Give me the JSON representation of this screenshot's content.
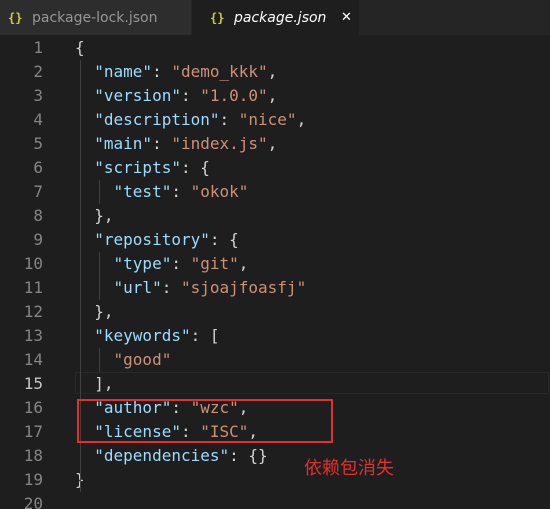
{
  "tabs": [
    {
      "icon": "{}",
      "label": "package-lock.json"
    },
    {
      "icon": "{}",
      "label": "package.json",
      "close": "✕"
    }
  ],
  "lines": [
    {
      "n": "1",
      "tokens": [
        {
          "t": "{",
          "c": "punc"
        }
      ]
    },
    {
      "n": "2",
      "tokens": [
        {
          "t": "  ",
          "c": "punc"
        },
        {
          "t": "\"name\"",
          "c": "key"
        },
        {
          "t": ": ",
          "c": "punc"
        },
        {
          "t": "\"demo_kkk\"",
          "c": "str"
        },
        {
          "t": ",",
          "c": "punc"
        }
      ]
    },
    {
      "n": "3",
      "tokens": [
        {
          "t": "  ",
          "c": "punc"
        },
        {
          "t": "\"version\"",
          "c": "key"
        },
        {
          "t": ": ",
          "c": "punc"
        },
        {
          "t": "\"1.0.0\"",
          "c": "str"
        },
        {
          "t": ",",
          "c": "punc"
        }
      ]
    },
    {
      "n": "4",
      "tokens": [
        {
          "t": "  ",
          "c": "punc"
        },
        {
          "t": "\"description\"",
          "c": "key"
        },
        {
          "t": ": ",
          "c": "punc"
        },
        {
          "t": "\"nice\"",
          "c": "str"
        },
        {
          "t": ",",
          "c": "punc"
        }
      ]
    },
    {
      "n": "5",
      "tokens": [
        {
          "t": "  ",
          "c": "punc"
        },
        {
          "t": "\"main\"",
          "c": "key"
        },
        {
          "t": ": ",
          "c": "punc"
        },
        {
          "t": "\"index.js\"",
          "c": "str"
        },
        {
          "t": ",",
          "c": "punc"
        }
      ]
    },
    {
      "n": "6",
      "tokens": [
        {
          "t": "  ",
          "c": "punc"
        },
        {
          "t": "\"scripts\"",
          "c": "key"
        },
        {
          "t": ": {",
          "c": "punc"
        }
      ]
    },
    {
      "n": "7",
      "tokens": [
        {
          "t": "    ",
          "c": "punc"
        },
        {
          "t": "\"test\"",
          "c": "key"
        },
        {
          "t": ": ",
          "c": "punc"
        },
        {
          "t": "\"okok\"",
          "c": "str"
        }
      ]
    },
    {
      "n": "8",
      "tokens": [
        {
          "t": "  },",
          "c": "punc"
        }
      ]
    },
    {
      "n": "9",
      "tokens": [
        {
          "t": "  ",
          "c": "punc"
        },
        {
          "t": "\"repository\"",
          "c": "key"
        },
        {
          "t": ": {",
          "c": "punc"
        }
      ]
    },
    {
      "n": "10",
      "tokens": [
        {
          "t": "    ",
          "c": "punc"
        },
        {
          "t": "\"type\"",
          "c": "key"
        },
        {
          "t": ": ",
          "c": "punc"
        },
        {
          "t": "\"git\"",
          "c": "str"
        },
        {
          "t": ",",
          "c": "punc"
        }
      ]
    },
    {
      "n": "11",
      "tokens": [
        {
          "t": "    ",
          "c": "punc"
        },
        {
          "t": "\"url\"",
          "c": "key"
        },
        {
          "t": ": ",
          "c": "punc"
        },
        {
          "t": "\"sjoajfoasfj\"",
          "c": "str"
        }
      ]
    },
    {
      "n": "12",
      "tokens": [
        {
          "t": "  },",
          "c": "punc"
        }
      ]
    },
    {
      "n": "13",
      "tokens": [
        {
          "t": "  ",
          "c": "punc"
        },
        {
          "t": "\"keywords\"",
          "c": "key"
        },
        {
          "t": ": [",
          "c": "punc"
        }
      ]
    },
    {
      "n": "14",
      "tokens": [
        {
          "t": "    ",
          "c": "punc"
        },
        {
          "t": "\"good\"",
          "c": "str"
        }
      ]
    },
    {
      "n": "15",
      "tokens": [
        {
          "t": "  ],",
          "c": "punc"
        }
      ],
      "current": true
    },
    {
      "n": "16",
      "tokens": [
        {
          "t": "  ",
          "c": "punc"
        },
        {
          "t": "\"author\"",
          "c": "key"
        },
        {
          "t": ": ",
          "c": "punc"
        },
        {
          "t": "\"wzc\"",
          "c": "str"
        },
        {
          "t": ",",
          "c": "punc"
        }
      ]
    },
    {
      "n": "17",
      "tokens": [
        {
          "t": "  ",
          "c": "punc"
        },
        {
          "t": "\"license\"",
          "c": "key"
        },
        {
          "t": ": ",
          "c": "punc"
        },
        {
          "t": "\"ISC\"",
          "c": "str"
        },
        {
          "t": ",",
          "c": "punc"
        }
      ]
    },
    {
      "n": "18",
      "tokens": [
        {
          "t": "  ",
          "c": "punc"
        },
        {
          "t": "\"dependencies\"",
          "c": "key"
        },
        {
          "t": ": {}",
          "c": "punc"
        }
      ]
    },
    {
      "n": "19",
      "tokens": [
        {
          "t": "}",
          "c": "punc"
        }
      ]
    },
    {
      "n": "20",
      "tokens": []
    }
  ],
  "annotation": {
    "text": "依赖包消失",
    "color": "#e0312d"
  },
  "colors": {
    "background": "#1e1e1e",
    "key": "#9cdcfe",
    "string": "#ce9178",
    "punctuation": "#d4d4d4",
    "json_icon": "#cbcb41"
  }
}
